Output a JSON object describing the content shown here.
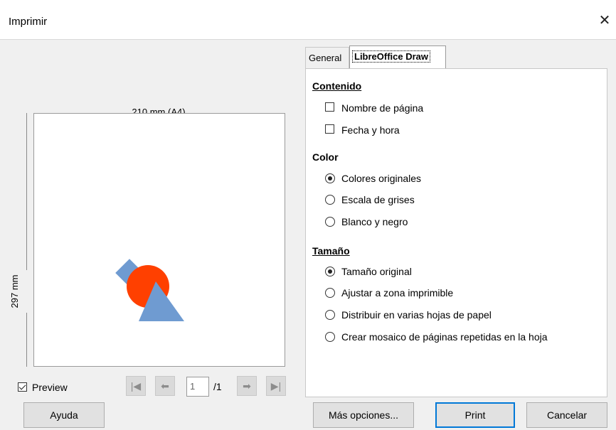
{
  "window": {
    "title": "Imprimir",
    "close_glyph": "✕"
  },
  "preview": {
    "width_label": "210 mm (A4)",
    "height_label": "297 mm",
    "preview_checkbox_label": "Preview",
    "preview_checked": true,
    "page_current": "1",
    "page_total": "/1",
    "nav_icons": [
      "first-page-icon",
      "prev-page-icon",
      "next-page-icon",
      "last-page-icon"
    ],
    "shape_colors": {
      "square": "#6f9bd1",
      "circle": "#ff4000",
      "triangle": "#6f9bd1"
    }
  },
  "tabs": [
    {
      "label": "General",
      "active": false
    },
    {
      "label": "LibreOffice Draw",
      "active": true
    }
  ],
  "contenido": {
    "title": "Contenido",
    "items": [
      {
        "label": "Nombre de página",
        "checked": false
      },
      {
        "label": "Fecha y hora",
        "checked": false
      }
    ]
  },
  "color": {
    "title": "Color",
    "items": [
      {
        "label": "Colores originales",
        "selected": true
      },
      {
        "label": "Escala de grises",
        "selected": false
      },
      {
        "label": "Blanco y negro",
        "selected": false
      }
    ]
  },
  "tamano": {
    "title": "Tamaño",
    "items": [
      {
        "label": "Tamaño original",
        "selected": true
      },
      {
        "label": "Ajustar a zona imprimible",
        "selected": false
      },
      {
        "label": "Distribuir en varias hojas de papel",
        "selected": false
      },
      {
        "label": "Crear mosaico de páginas repetidas en la hoja",
        "selected": false
      }
    ]
  },
  "buttons": {
    "help": "Ayuda",
    "more_options": "Más opciones...",
    "print": "Print",
    "cancel": "Cancelar"
  }
}
